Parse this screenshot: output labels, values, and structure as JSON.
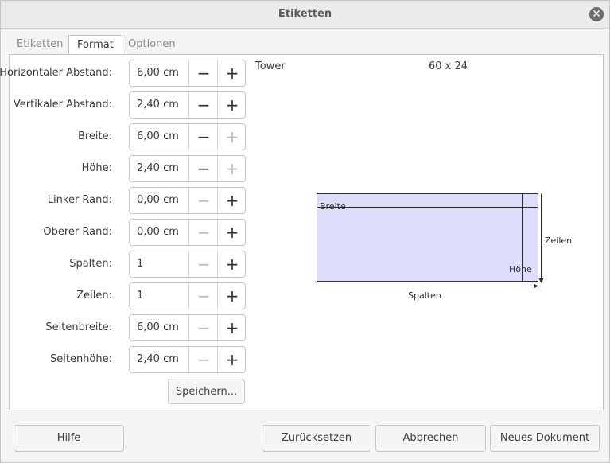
{
  "window": {
    "title": "Etiketten"
  },
  "tabs": [
    {
      "label": "Etiketten"
    },
    {
      "label": "Format"
    },
    {
      "label": "Optionen"
    }
  ],
  "fields": [
    {
      "label": "Horizontaler Abstand:",
      "value": "6,00 cm",
      "minus_enabled": true,
      "plus_enabled": true
    },
    {
      "label": "Vertikaler Abstand:",
      "value": "2,40 cm",
      "minus_enabled": true,
      "plus_enabled": true
    },
    {
      "label": "Breite:",
      "value": "6,00 cm",
      "minus_enabled": true,
      "plus_enabled": false
    },
    {
      "label": "Höhe:",
      "value": "2,40 cm",
      "minus_enabled": true,
      "plus_enabled": false
    },
    {
      "label": "Linker Rand:",
      "value": "0,00 cm",
      "minus_enabled": false,
      "plus_enabled": true
    },
    {
      "label": "Oberer Rand:",
      "value": "0,00 cm",
      "minus_enabled": false,
      "plus_enabled": true
    },
    {
      "label": "Spalten:",
      "value": "1",
      "minus_enabled": false,
      "plus_enabled": true
    },
    {
      "label": "Zeilen:",
      "value": "1",
      "minus_enabled": false,
      "plus_enabled": true
    },
    {
      "label": "Seitenbreite:",
      "value": "6,00 cm",
      "minus_enabled": false,
      "plus_enabled": true
    },
    {
      "label": "Seitenhöhe:",
      "value": "2,40 cm",
      "minus_enabled": false,
      "plus_enabled": true
    }
  ],
  "save_label": "Speichern...",
  "preview": {
    "brand": "Tower",
    "type": "60 x 24",
    "label_breite": "Breite",
    "label_hoehe": "Höhe",
    "label_zeilen": "Zeilen",
    "label_spalten": "Spalten",
    "fill_color": "#dcdcfc"
  },
  "footer": {
    "help": "Hilfe",
    "reset": "Zurücksetzen",
    "cancel": "Abbrechen",
    "new_document": "Neues Dokument"
  }
}
